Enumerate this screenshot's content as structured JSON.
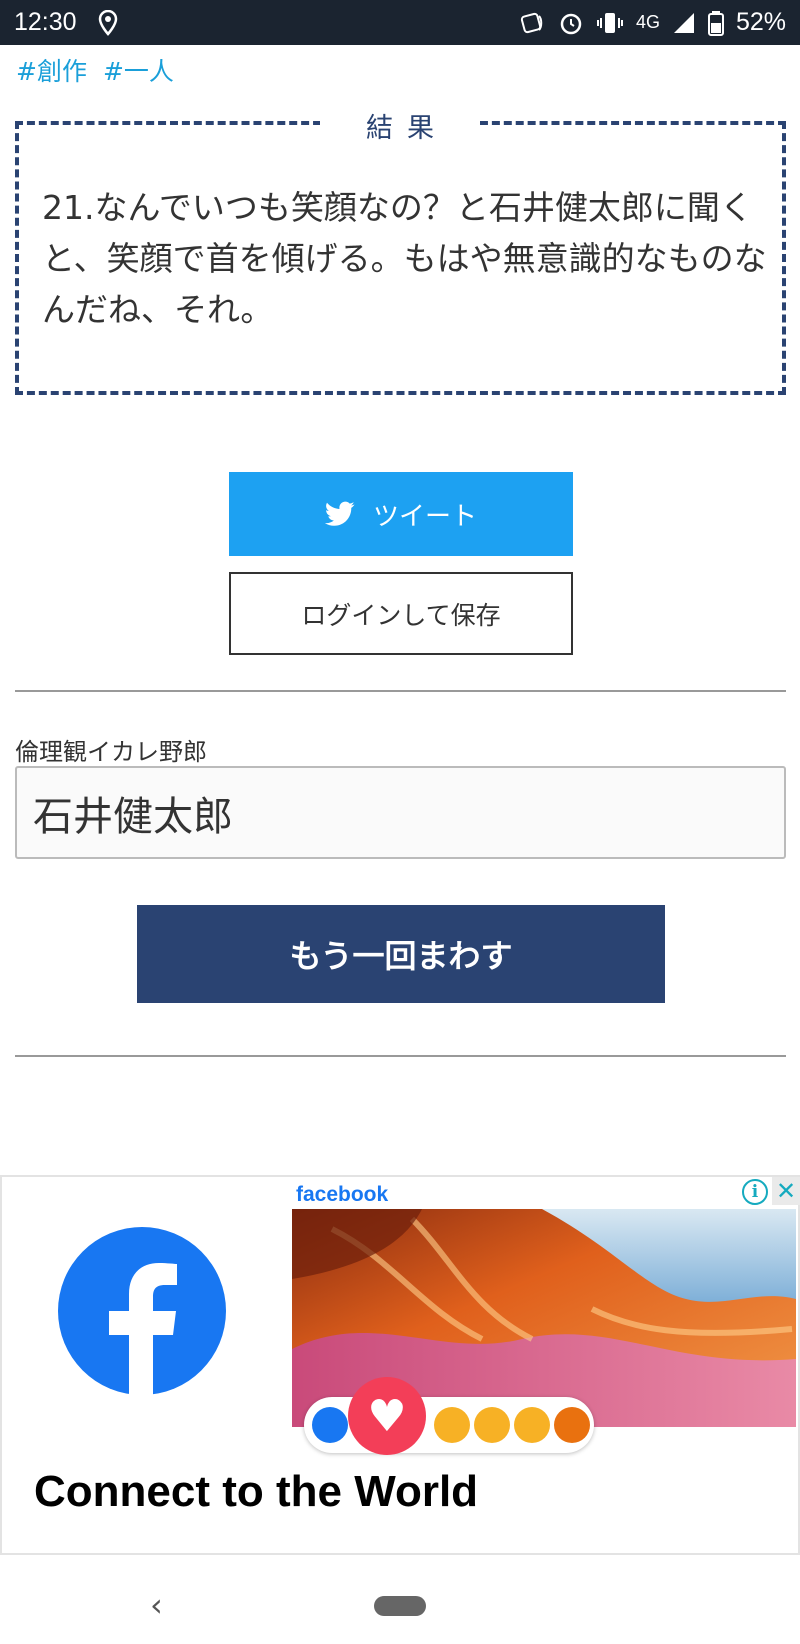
{
  "status_bar": {
    "time": "12:30",
    "network": "4G",
    "battery": "52%"
  },
  "tags": [
    "#創作",
    "#一人"
  ],
  "result": {
    "heading": "結果",
    "text": "21.なんでいつも笑顔なの？と石井健太郎に聞くと、笑顔で首を傾げる。もはや無意識的なものなんだね、それ。"
  },
  "buttons": {
    "tweet": "ツイート",
    "login_save": "ログインして保存",
    "spin_again": "もう一回まわす"
  },
  "form": {
    "label": "倫理観イカレ野郎",
    "name_value": "石井健太郎"
  },
  "ad": {
    "brand": "facebook",
    "headline": "Connect to the World"
  },
  "colors": {
    "navy": "#2a4372",
    "twitter": "#1da1f2",
    "tag": "#1a9fd9",
    "facebook": "#1877f2"
  }
}
